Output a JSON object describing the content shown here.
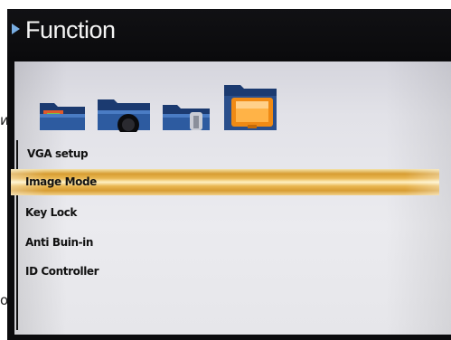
{
  "header": {
    "title": "Function"
  },
  "background_fragments": [
    "и",
    "о"
  ],
  "icons": [
    {
      "name": "image-folder-icon"
    },
    {
      "name": "camera-folder-icon"
    },
    {
      "name": "tools-folder-icon"
    },
    {
      "name": "monitor-folder-icon",
      "selected": true
    }
  ],
  "menu": {
    "items": [
      {
        "label": "VGA setup"
      },
      {
        "label": "Image Mode",
        "selected": true
      },
      {
        "label": "Key Lock"
      },
      {
        "label": "Anti Buin-in"
      },
      {
        "label": "ID Controller"
      }
    ]
  },
  "colors": {
    "title_bar": "#0b0b0d",
    "panel": "#e6e6ea",
    "highlight": "#e0a83c",
    "folder_blue": "#1d4284",
    "folder_orange": "#e07a10"
  }
}
